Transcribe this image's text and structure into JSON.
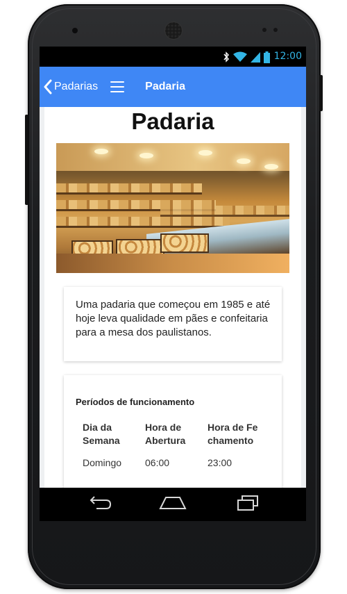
{
  "status_bar": {
    "time": "12:00",
    "icons": [
      "bluetooth-icon",
      "wifi-icon",
      "signal-icon",
      "battery-icon"
    ],
    "accent_color": "#33b5e5"
  },
  "app_bar": {
    "back_label": "Padarias",
    "title": "Padaria",
    "color": "#3f87f5"
  },
  "page": {
    "title": "Padaria",
    "description": "Uma padaria que começou em 1985 e até hoje leva qualidade em pães e confeitaria para a mesa dos paulistanos."
  },
  "hours": {
    "heading": "Períodos de funcionamento",
    "columns": [
      "Dia da Semana",
      "Hora de Abertura",
      "Hora de Fechamento"
    ],
    "rows": [
      {
        "day": "Domingo",
        "open": "06:00",
        "close": "23:00"
      }
    ]
  },
  "nav_bar": {
    "buttons": [
      "back-icon",
      "home-icon",
      "recents-icon"
    ]
  }
}
